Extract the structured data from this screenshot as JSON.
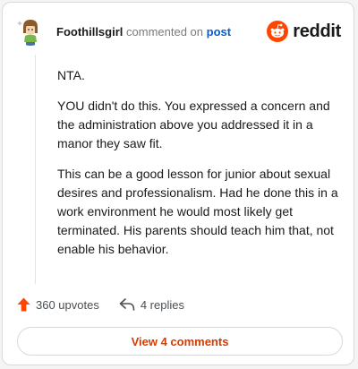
{
  "header": {
    "author": "Foothillsgirl",
    "verb": "commented on",
    "link": "post",
    "brand": "reddit"
  },
  "comment": {
    "paragraphs": [
      "NTA.",
      "YOU didn't do this. You expressed a concern and the administration above you addressed it in a manor they saw fit.",
      "This can be a good lesson for junior about sexual desires and professionalism. Had he done this in a work environment he would most likely get terminated. His parents should teach him that, not enable his behavior."
    ]
  },
  "stats": {
    "upvotes": "360 upvotes",
    "replies": "4 replies"
  },
  "cta": {
    "label": "View 4 comments"
  },
  "icons": {
    "avatar": "avatar-icon",
    "brand": "reddit-snoo-icon",
    "upvote": "upvote-arrow-icon",
    "reply": "reply-arrow-icon"
  },
  "colors": {
    "brand_orange": "#ff4500",
    "link_blue": "#0b5ec9",
    "cta_text": "#d93a00",
    "muted": "#787c7e"
  }
}
